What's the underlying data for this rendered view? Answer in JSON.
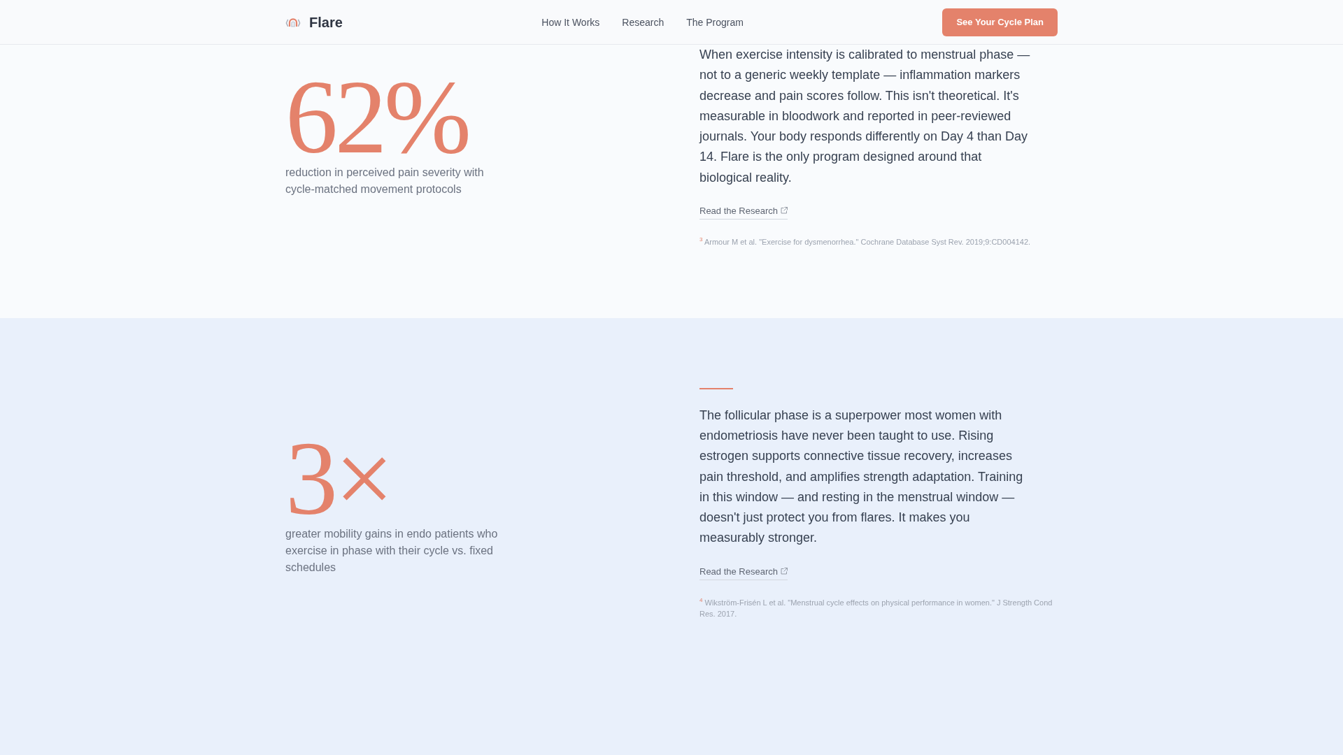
{
  "header": {
    "brand": "Flare",
    "nav": [
      {
        "label": "How It Works"
      },
      {
        "label": "Research"
      },
      {
        "label": "The Program"
      }
    ],
    "cta": "See Your Cycle Plan"
  },
  "sections": [
    {
      "stat": "62%",
      "caption": "reduction in perceived pain severity with cycle-matched movement protocols",
      "accent_rule": false,
      "body": "When exercise intensity is calibrated to menstrual phase — not to a generic weekly template — inflammation markers decrease and pain scores follow. This isn't theoretical. It's measurable in bloodwork and reported in peer-reviewed journals. Your body responds differently on Day 4 than Day 14. Flare is the only program designed around that biological reality.",
      "link": "Read the Research",
      "footnote": "$^{3}$ Armour M et al. \"Exercise for dysmenorrhea.\" Cochrane Database Syst Rev. 2019;9:CD004142."
    },
    {
      "stat": "3×",
      "caption": "greater mobility gains in endo patients who exercise in phase with their cycle vs. fixed schedules",
      "accent_rule": true,
      "body": "The follicular phase is a superpower most women with endometriosis have never been taught to use. Rising estrogen supports connective tissue recovery, increases pain threshold, and amplifies strength adaptation. Training in this window — and resting in the menstrual window — doesn't just protect you from flares. It makes you measurably stronger.",
      "link": "Read the Research",
      "footnote": "$^{4}$ Wikström-Frisén L et al. \"Menstrual cycle effects on physical performance in women.\" J Strength Cond Res. 2017."
    }
  ]
}
